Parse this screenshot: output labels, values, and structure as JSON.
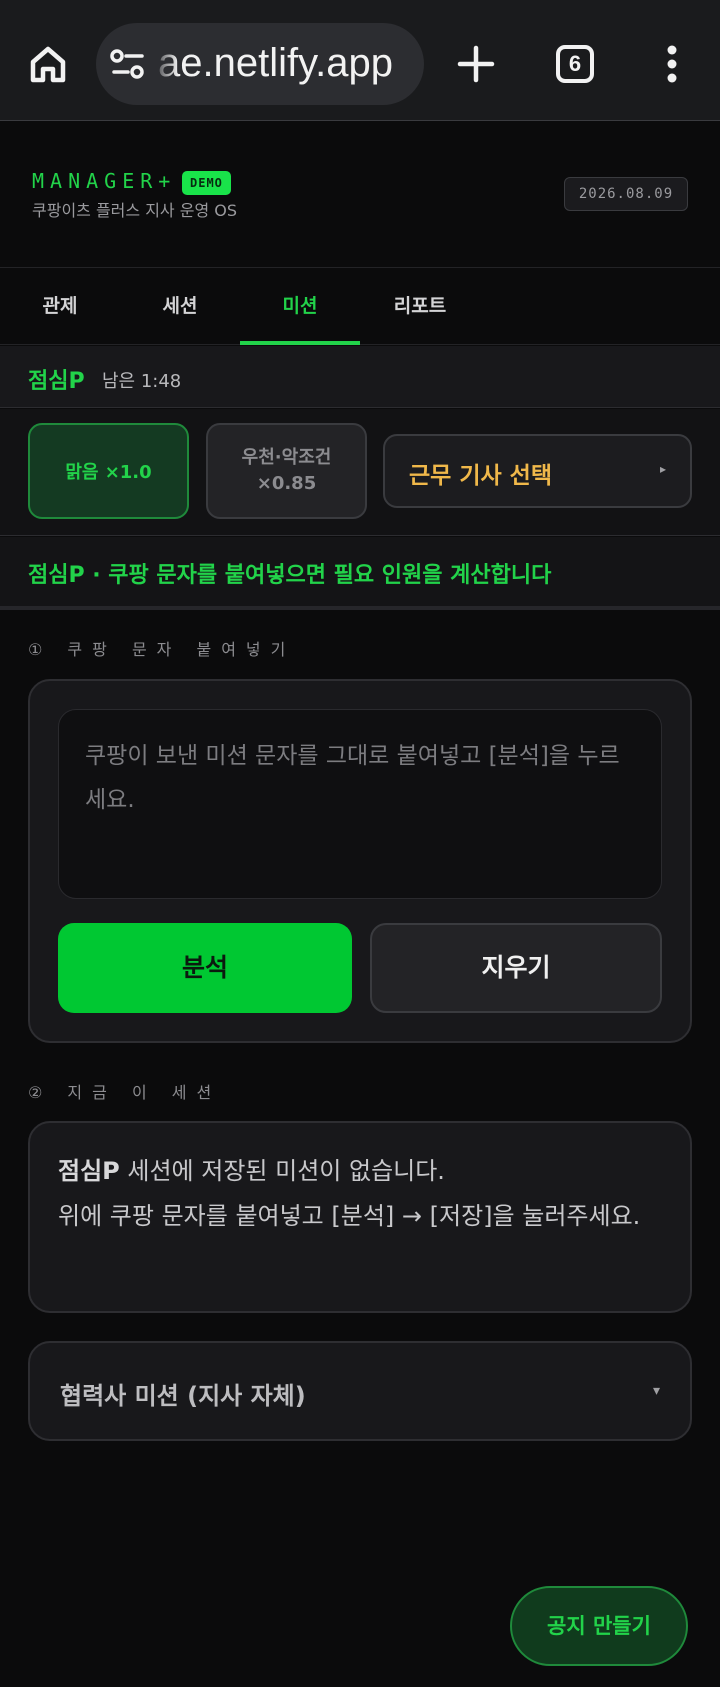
{
  "browser": {
    "url": "ae.netlify.app",
    "tab_count": "6",
    "icons": [
      "home-icon",
      "site-settings-icon",
      "plus-icon",
      "tabs-icon",
      "more-vert-icon"
    ]
  },
  "header": {
    "brand": "MANAGER+",
    "badge": "DEMO",
    "subtitle": "쿠팡이츠 플러스 지사 운영 OS",
    "date": "2026.08.09"
  },
  "tabs": [
    {
      "label": "관제",
      "active": false
    },
    {
      "label": "세션",
      "active": false
    },
    {
      "label": "미션",
      "active": true
    },
    {
      "label": "리포트",
      "active": false
    }
  ],
  "session": {
    "name": "점심P",
    "remaining": "남은 1:48"
  },
  "conditions": {
    "clear": "맑음 ×1.0",
    "bad_line1": "우천·악조건",
    "bad_line2": "×0.85",
    "driver_select": "근무 기사 선택",
    "driver_arrow": "▸"
  },
  "banner": "점심P · 쿠팡 문자를 붙여넣으면 필요 인원을 계산합니다",
  "paste_section": {
    "title": "① 쿠팡 문자 붙여넣기",
    "placeholder": "쿠팡이 보낸 미션 문자를 그대로 붙여넣고 [분석]을 누르세요.",
    "analyze": "분석",
    "clear": "지우기"
  },
  "current_section": {
    "title": "② 지금 이 세션",
    "session_name": "점심P",
    "msg_part1": " 세션에 저장된 미션이 없습니다.",
    "msg_part2": "위에 쿠팡 문자를 붙여넣고 [분석] → [저장]을 눌러주세요."
  },
  "partner": {
    "title": "협력사 미션 (지사 자체)",
    "arrow": "▾"
  },
  "fab": "공지 만들기",
  "colors": {
    "accent": "#22d34a",
    "primary_button": "#00c832",
    "warning_text": "#f0b84a",
    "background": "#0b0b0c"
  }
}
